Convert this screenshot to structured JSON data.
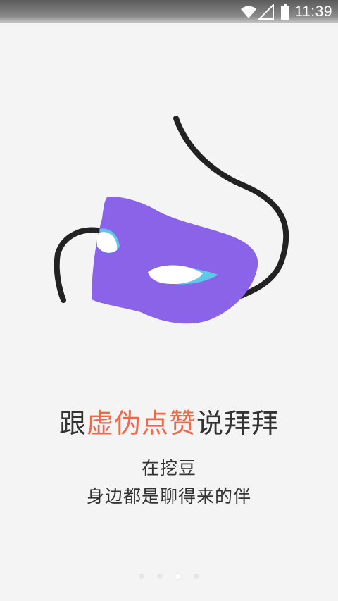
{
  "status_bar": {
    "time": "11:39",
    "icons": [
      "wifi-icon",
      "cellular-signal-icon",
      "battery-icon"
    ]
  },
  "onboarding": {
    "illustration": "masquerade-mask",
    "headline": {
      "prefix": "跟",
      "highlight": "虚伪点赞",
      "suffix": "说拜拜"
    },
    "subtitle_line1": "在挖豆",
    "subtitle_line2": "身边都是聊得来的伴",
    "page_indicator": {
      "total": 4,
      "current": 3
    }
  },
  "colors": {
    "background": "#f4f4f4",
    "mask_purple": "#8a63e8",
    "eye_accent": "#5ec8e8",
    "highlight_text": "#f1674a",
    "body_text": "#333333"
  }
}
